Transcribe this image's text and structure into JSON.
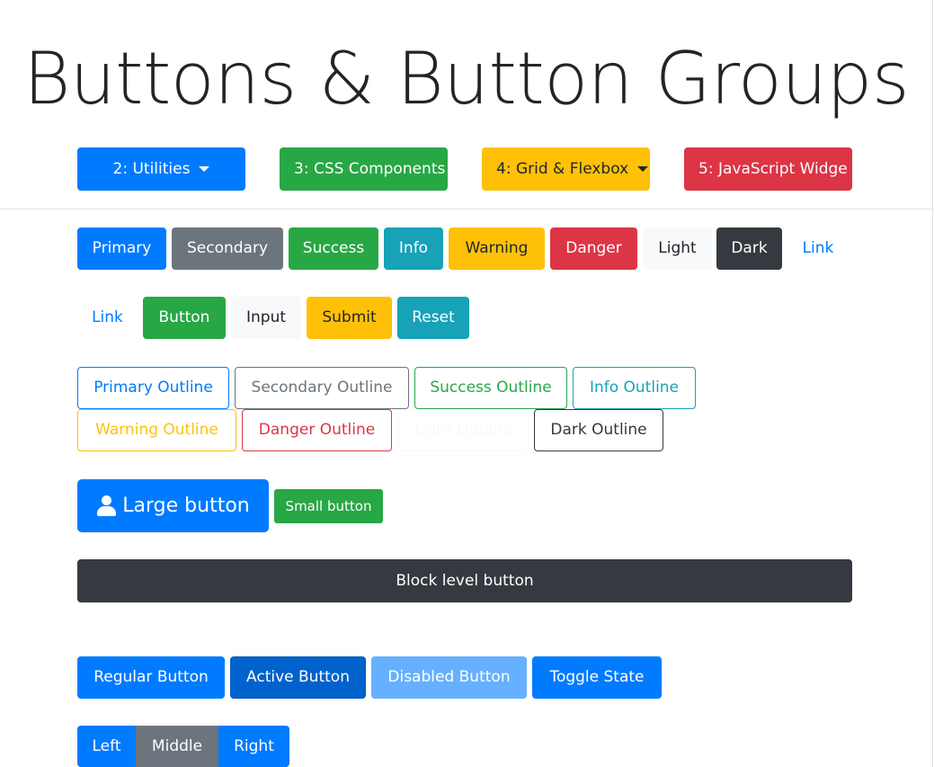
{
  "page_title": "Buttons & Button Groups",
  "nav": {
    "utilities": "2: Utilities",
    "css_components": "3: CSS Components",
    "grid_flexbox": "4: Grid & Flexbox",
    "javascript_widgets": "5: JavaScript Widge"
  },
  "solid_buttons": {
    "primary": "Primary",
    "secondary": "Secondary",
    "success": "Success",
    "info": "Info",
    "warning": "Warning",
    "danger": "Danger",
    "light": "Light",
    "dark": "Dark",
    "link": "Link"
  },
  "element_buttons": {
    "link": "Link",
    "button": "Button",
    "input": "Input",
    "submit": "Submit",
    "reset": "Reset"
  },
  "outline_buttons": {
    "primary": "Primary Outline",
    "secondary": "Secondary Outline",
    "success": "Success Outline",
    "info": "Info Outline",
    "warning": "Warning Outline",
    "danger": "Danger Outline",
    "light": "Light Outline",
    "dark": "Dark Outline"
  },
  "sizes": {
    "large": "Large button",
    "small": "Small button",
    "block": "Block level button"
  },
  "states": {
    "regular": "Regular Button",
    "active": "Active Button",
    "disabled": "Disabled Button",
    "toggle": "Toggle State"
  },
  "group": {
    "left": "Left",
    "middle": "Middle",
    "right": "Right"
  },
  "colors": {
    "primary": "#007bff",
    "secondary": "#6c757d",
    "success": "#28a745",
    "info": "#17a2b8",
    "warning": "#ffc107",
    "danger": "#dc3545",
    "light": "#f8f9fa",
    "dark": "#343a40"
  }
}
